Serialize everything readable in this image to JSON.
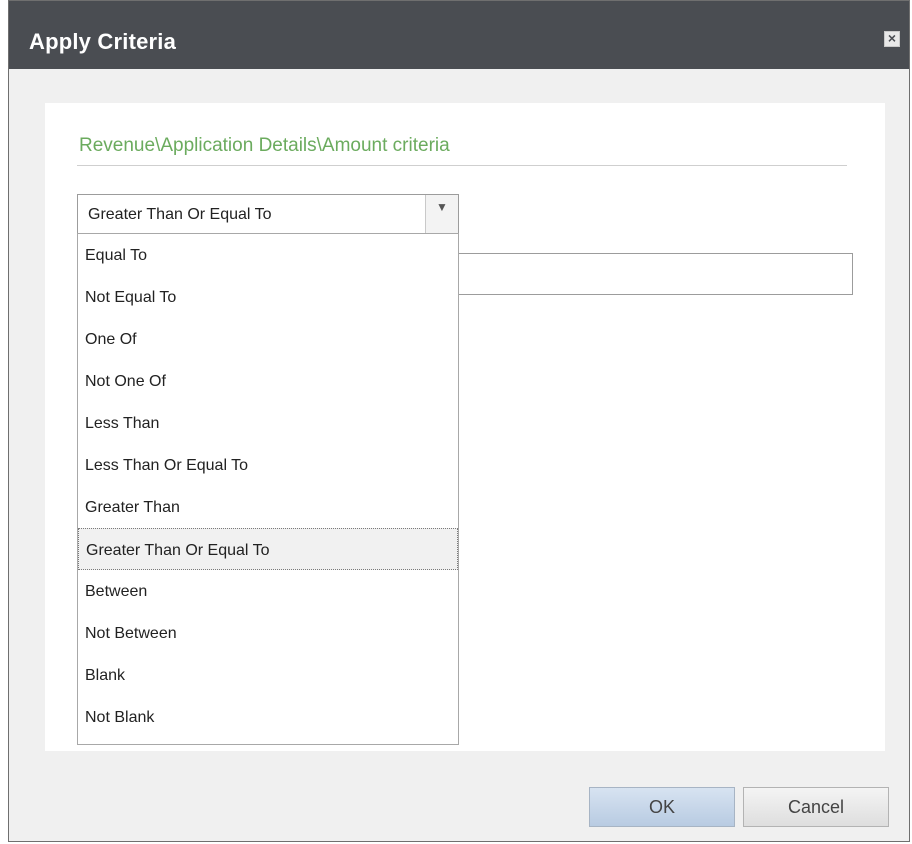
{
  "dialog": {
    "title": "Apply Criteria",
    "close_icon": "close-icon"
  },
  "criteria": {
    "path": "Revenue\\Application Details\\Amount criteria",
    "operator_selected": "Greater Than Or Equal To",
    "value": ""
  },
  "dropdown": {
    "options": [
      "Equal To",
      "Not Equal To",
      "One Of",
      "Not One Of",
      "Less Than",
      "Less Than Or Equal To",
      "Greater Than",
      "Greater Than Or Equal To",
      "Between",
      "Not Between",
      "Blank",
      "Not Blank"
    ]
  },
  "buttons": {
    "ok": "OK",
    "cancel": "Cancel"
  },
  "colors": {
    "titlebar": "#4a4d52",
    "path_text": "#6bab5e"
  }
}
